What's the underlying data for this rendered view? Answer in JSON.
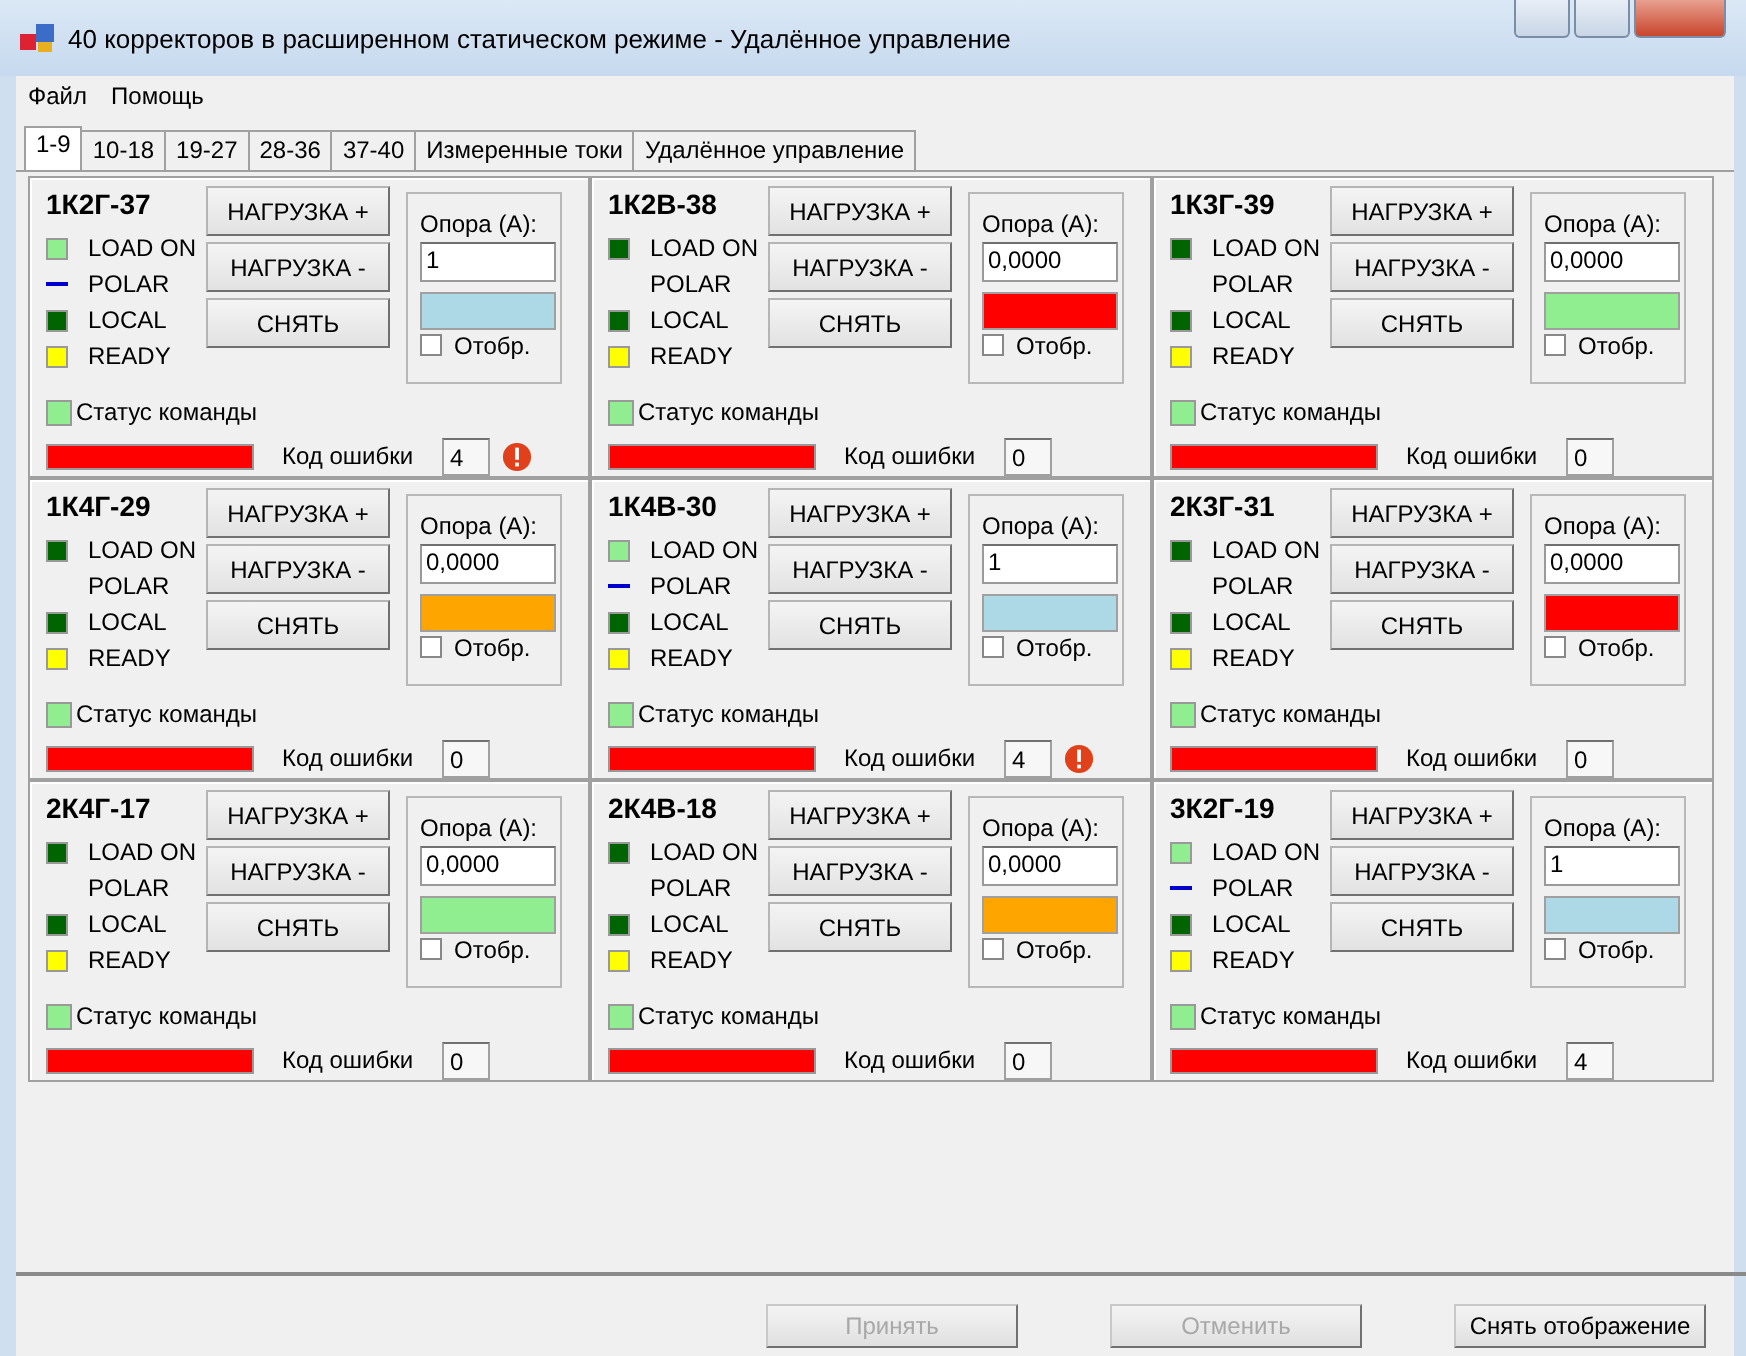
{
  "window": {
    "title": "40 корректоров в расширенном статическом  режиме - Удалённое управление"
  },
  "menu": [
    "Файл",
    "Помощь"
  ],
  "tabs": [
    {
      "label": "1-9",
      "selected": true
    },
    {
      "label": "10-18",
      "selected": false
    },
    {
      "label": "19-27",
      "selected": false
    },
    {
      "label": "28-36",
      "selected": false
    },
    {
      "label": "37-40",
      "selected": false
    },
    {
      "label": "Измеренные токи",
      "selected": false
    },
    {
      "label": "Удалённое управление",
      "selected": false
    }
  ],
  "panels": [
    {
      "name": "1К2Г-37",
      "indicators": [
        {
          "label": "LOAD ON",
          "kind": "box",
          "color": "#90ee90"
        },
        {
          "label": "POLAR",
          "kind": "line",
          "color": "#0000cd"
        },
        {
          "label": "LOCAL",
          "kind": "box",
          "color": "#006400"
        },
        {
          "label": "READY",
          "kind": "box",
          "color": "#ffff00"
        }
      ],
      "buttons": [
        "НАГРУЗКА +",
        "НАГРУЗКА -",
        "СНЯТЬ"
      ],
      "reference_label": "Опора (А):",
      "reference": "1",
      "swatch": {
        "color": "#add8e6"
      },
      "display_label": "Отобр.",
      "display_checked": false,
      "status": {
        "label": "Статус команды",
        "color": "#90ee90"
      },
      "error_bar": {
        "color": "#ff0000"
      },
      "error_label": "Код ошибки",
      "error_code": "4",
      "warning": true
    },
    {
      "name": "1К2В-38",
      "indicators": [
        {
          "label": "LOAD ON",
          "kind": "box",
          "color": "#006400"
        },
        {
          "label": "POLAR",
          "kind": "none"
        },
        {
          "label": "LOCAL",
          "kind": "box",
          "color": "#006400"
        },
        {
          "label": "READY",
          "kind": "box",
          "color": "#ffff00"
        }
      ],
      "buttons": [
        "НАГРУЗКА +",
        "НАГРУЗКА -",
        "СНЯТЬ"
      ],
      "reference_label": "Опора (А):",
      "reference": "0,0000",
      "swatch": {
        "color": "#ff0000"
      },
      "display_label": "Отобр.",
      "display_checked": false,
      "status": {
        "label": "Статус команды",
        "color": "#90ee90"
      },
      "error_bar": {
        "color": "#ff0000"
      },
      "error_label": "Код ошибки",
      "error_code": "0",
      "warning": false
    },
    {
      "name": "1К3Г-39",
      "indicators": [
        {
          "label": "LOAD ON",
          "kind": "box",
          "color": "#006400"
        },
        {
          "label": "POLAR",
          "kind": "none"
        },
        {
          "label": "LOCAL",
          "kind": "box",
          "color": "#006400"
        },
        {
          "label": "READY",
          "kind": "box",
          "color": "#ffff00"
        }
      ],
      "buttons": [
        "НАГРУЗКА +",
        "НАГРУЗКА -",
        "СНЯТЬ"
      ],
      "reference_label": "Опора (А):",
      "reference": "0,0000",
      "swatch": {
        "color": "#90ee90"
      },
      "display_label": "Отобр.",
      "display_checked": false,
      "status": {
        "label": "Статус команды",
        "color": "#90ee90"
      },
      "error_bar": {
        "color": "#ff0000"
      },
      "error_label": "Код ошибки",
      "error_code": "0",
      "warning": false
    },
    {
      "name": "1К4Г-29",
      "indicators": [
        {
          "label": "LOAD ON",
          "kind": "box",
          "color": "#006400"
        },
        {
          "label": "POLAR",
          "kind": "none"
        },
        {
          "label": "LOCAL",
          "kind": "box",
          "color": "#006400"
        },
        {
          "label": "READY",
          "kind": "box",
          "color": "#ffff00"
        }
      ],
      "buttons": [
        "НАГРУЗКА +",
        "НАГРУЗКА -",
        "СНЯТЬ"
      ],
      "reference_label": "Опора (А):",
      "reference": "0,0000",
      "swatch": {
        "color": "#ffa500"
      },
      "display_label": "Отобр.",
      "display_checked": false,
      "status": {
        "label": "Статус команды",
        "color": "#90ee90"
      },
      "error_bar": {
        "color": "#ff0000"
      },
      "error_label": "Код ошибки",
      "error_code": "0",
      "warning": false
    },
    {
      "name": "1К4В-30",
      "indicators": [
        {
          "label": "LOAD ON",
          "kind": "box",
          "color": "#90ee90"
        },
        {
          "label": "POLAR",
          "kind": "line",
          "color": "#0000cd"
        },
        {
          "label": "LOCAL",
          "kind": "box",
          "color": "#006400"
        },
        {
          "label": "READY",
          "kind": "box",
          "color": "#ffff00"
        }
      ],
      "buttons": [
        "НАГРУЗКА +",
        "НАГРУЗКА -",
        "СНЯТЬ"
      ],
      "reference_label": "Опора (А):",
      "reference": "1",
      "swatch": {
        "color": "#add8e6"
      },
      "display_label": "Отобр.",
      "display_checked": false,
      "status": {
        "label": "Статус команды",
        "color": "#90ee90"
      },
      "error_bar": {
        "color": "#ff0000"
      },
      "error_label": "Код ошибки",
      "error_code": "4",
      "warning": true
    },
    {
      "name": "2К3Г-31",
      "indicators": [
        {
          "label": "LOAD ON",
          "kind": "box",
          "color": "#006400"
        },
        {
          "label": "POLAR",
          "kind": "none"
        },
        {
          "label": "LOCAL",
          "kind": "box",
          "color": "#006400"
        },
        {
          "label": "READY",
          "kind": "box",
          "color": "#ffff00"
        }
      ],
      "buttons": [
        "НАГРУЗКА +",
        "НАГРУЗКА -",
        "СНЯТЬ"
      ],
      "reference_label": "Опора (А):",
      "reference": "0,0000",
      "swatch": {
        "color": "#ff0000"
      },
      "display_label": "Отобр.",
      "display_checked": false,
      "status": {
        "label": "Статус команды",
        "color": "#90ee90"
      },
      "error_bar": {
        "color": "#ff0000"
      },
      "error_label": "Код ошибки",
      "error_code": "0",
      "warning": false
    },
    {
      "name": "2К4Г-17",
      "indicators": [
        {
          "label": "LOAD ON",
          "kind": "box",
          "color": "#006400"
        },
        {
          "label": "POLAR",
          "kind": "none"
        },
        {
          "label": "LOCAL",
          "kind": "box",
          "color": "#006400"
        },
        {
          "label": "READY",
          "kind": "box",
          "color": "#ffff00"
        }
      ],
      "buttons": [
        "НАГРУЗКА +",
        "НАГРУЗКА -",
        "СНЯТЬ"
      ],
      "reference_label": "Опора (А):",
      "reference": "0,0000",
      "swatch": {
        "color": "#90ee90"
      },
      "display_label": "Отобр.",
      "display_checked": false,
      "status": {
        "label": "Статус команды",
        "color": "#90ee90"
      },
      "error_bar": {
        "color": "#ff0000"
      },
      "error_label": "Код ошибки",
      "error_code": "0",
      "warning": false
    },
    {
      "name": "2К4В-18",
      "indicators": [
        {
          "label": "LOAD ON",
          "kind": "box",
          "color": "#006400"
        },
        {
          "label": "POLAR",
          "kind": "none"
        },
        {
          "label": "LOCAL",
          "kind": "box",
          "color": "#006400"
        },
        {
          "label": "READY",
          "kind": "box",
          "color": "#ffff00"
        }
      ],
      "buttons": [
        "НАГРУЗКА +",
        "НАГРУЗКА -",
        "СНЯТЬ"
      ],
      "reference_label": "Опора (А):",
      "reference": "0,0000",
      "swatch": {
        "color": "#ffa500"
      },
      "display_label": "Отобр.",
      "display_checked": false,
      "status": {
        "label": "Статус команды",
        "color": "#90ee90"
      },
      "error_bar": {
        "color": "#ff0000"
      },
      "error_label": "Код ошибки",
      "error_code": "0",
      "warning": false
    },
    {
      "name": "3К2Г-19",
      "indicators": [
        {
          "label": "LOAD ON",
          "kind": "box",
          "color": "#90ee90"
        },
        {
          "label": "POLAR",
          "kind": "line",
          "color": "#0000cd"
        },
        {
          "label": "LOCAL",
          "kind": "box",
          "color": "#006400"
        },
        {
          "label": "READY",
          "kind": "box",
          "color": "#ffff00"
        }
      ],
      "buttons": [
        "НАГРУЗКА +",
        "НАГРУЗКА -",
        "СНЯТЬ"
      ],
      "reference_label": "Опора (А):",
      "reference": "1",
      "swatch": {
        "color": "#add8e6"
      },
      "display_label": "Отобр.",
      "display_checked": false,
      "status": {
        "label": "Статус команды",
        "color": "#90ee90"
      },
      "error_bar": {
        "color": "#ff0000"
      },
      "error_label": "Код ошибки",
      "error_code": "4",
      "warning": false
    }
  ],
  "buttons": [
    {
      "label": "Принять",
      "disabled": true
    },
    {
      "label": "Отменить",
      "disabled": true
    },
    {
      "label": "Снять отображение",
      "disabled": false
    }
  ]
}
